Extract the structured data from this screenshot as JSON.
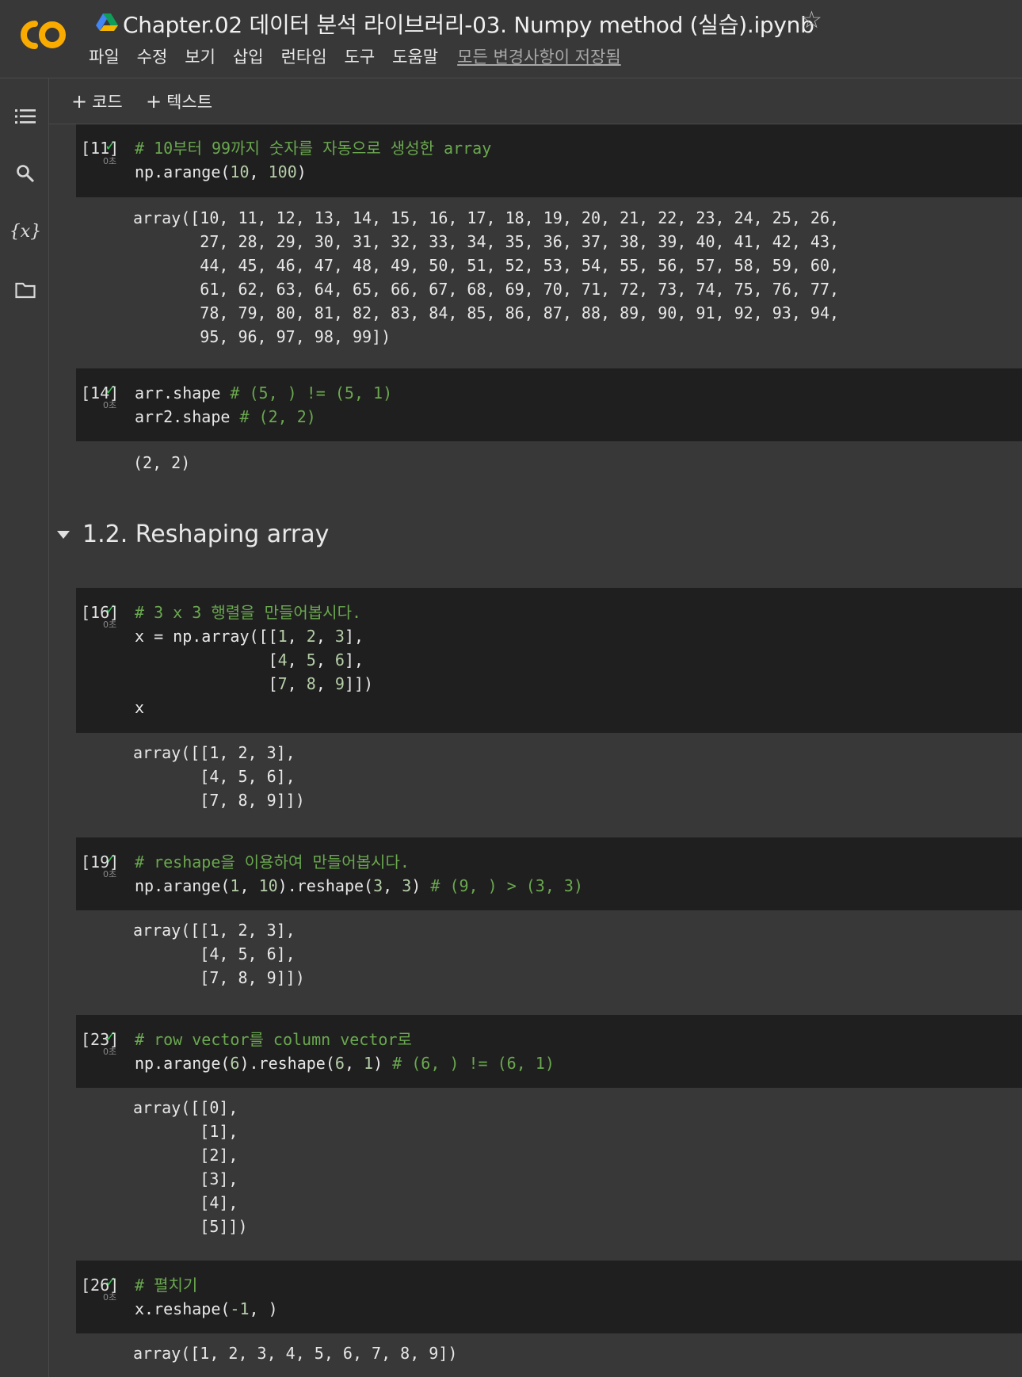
{
  "app": {
    "title": "Chapter.02 데이터 분석 라이브러리-03. Numpy method (실습).ipynb",
    "menu": [
      "파일",
      "수정",
      "보기",
      "삽입",
      "런타임",
      "도구",
      "도움말"
    ],
    "saved_status": "모든 변경사항이 저장됨"
  },
  "toolbar": {
    "add_code": "코드",
    "add_text": "텍스트"
  },
  "rail_icons": [
    "toc-icon",
    "search-icon",
    "variables-icon",
    "folder-icon"
  ],
  "cells": [
    {
      "count": "[11]",
      "time": "0초",
      "code": [
        "# 10부터 99까지 숫자를 자동으로 생성한 array",
        "np.arange(10, 100)"
      ],
      "output": [
        "array([10, 11, 12, 13, 14, 15, 16, 17, 18, 19, 20, 21, 22, 23, 24, 25, 26,",
        "       27, 28, 29, 30, 31, 32, 33, 34, 35, 36, 37, 38, 39, 40, 41, 42, 43,",
        "       44, 45, 46, 47, 48, 49, 50, 51, 52, 53, 54, 55, 56, 57, 58, 59, 60,",
        "       61, 62, 63, 64, 65, 66, 67, 68, 69, 70, 71, 72, 73, 74, 75, 76, 77,",
        "       78, 79, 80, 81, 82, 83, 84, 85, 86, 87, 88, 89, 90, 91, 92, 93, 94,",
        "       95, 96, 97, 98, 99])"
      ]
    },
    {
      "count": "[14]",
      "time": "0초",
      "code": [
        "arr.shape # (5, ) != (5, 1)",
        "arr2.shape # (2, 2)"
      ],
      "output": [
        "(2, 2)"
      ]
    },
    {
      "count": "[16]",
      "time": "0초",
      "code": [
        "# 3 x 3 행렬을 만들어봅시다.",
        "x = np.array([[1, 2, 3],",
        "              [4, 5, 6],",
        "              [7, 8, 9]])",
        "x"
      ],
      "output": [
        "array([[1, 2, 3],",
        "       [4, 5, 6],",
        "       [7, 8, 9]])"
      ]
    },
    {
      "count": "[19]",
      "time": "0초",
      "code": [
        "# reshape을 이용하여 만들어봅시다.",
        "np.arange(1, 10).reshape(3, 3) # (9, ) > (3, 3)"
      ],
      "output": [
        "array([[1, 2, 3],",
        "       [4, 5, 6],",
        "       [7, 8, 9]])"
      ]
    },
    {
      "count": "[23]",
      "time": "0초",
      "code": [
        "# row vector를 column vector로",
        "np.arange(6).reshape(6, 1) # (6, ) != (6, 1)"
      ],
      "output": [
        "array([[0],",
        "       [1],",
        "       [2],",
        "       [3],",
        "       [4],",
        "       [5]])"
      ]
    },
    {
      "count": "[26]",
      "time": "0초",
      "code": [
        "# 펼치기",
        "x.reshape(-1, )"
      ],
      "output": [
        "array([1, 2, 3, 4, 5, 6, 7, 8, 9])"
      ]
    }
  ],
  "section": {
    "title": "1.2. Reshaping array"
  },
  "colors": {
    "accent_orange": "#f9ab00",
    "check_green": "#36c552",
    "comment_green": "#6aa84f"
  }
}
